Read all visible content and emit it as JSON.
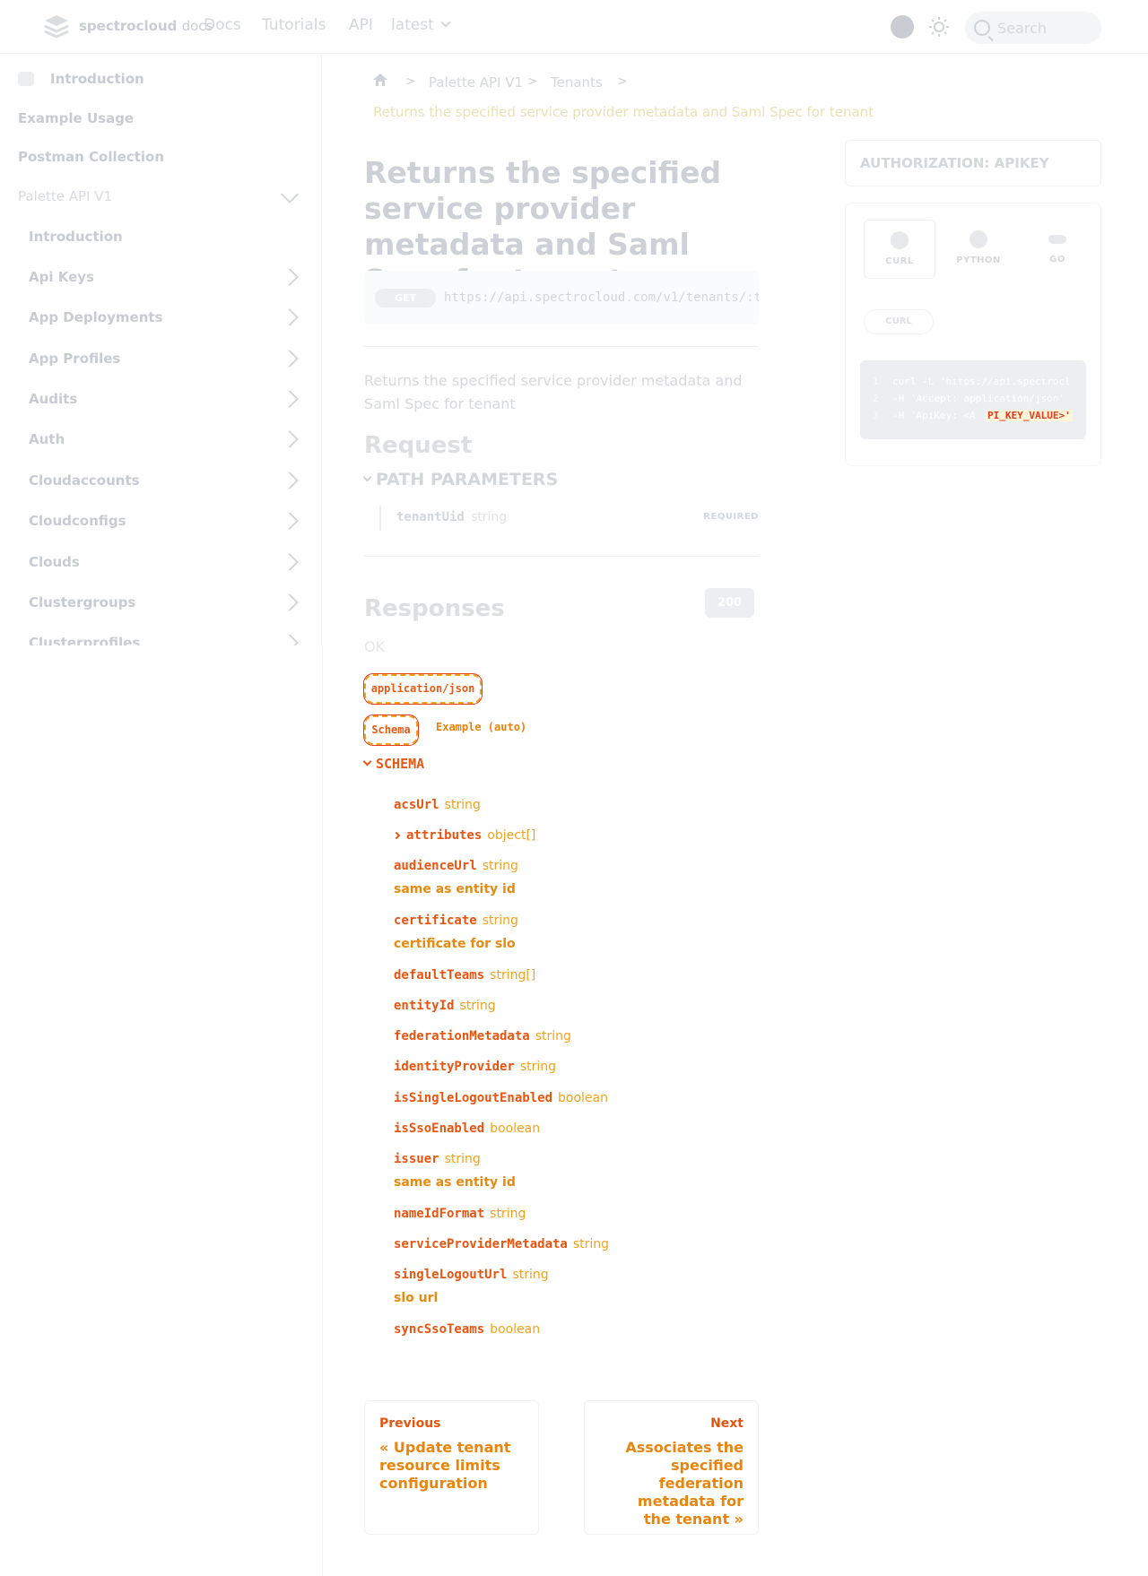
{
  "nav": {
    "logo_brand": "spectrocloud",
    "logo_suffix": "docs",
    "links": [
      "Docs",
      "Tutorials",
      "API",
      "latest"
    ],
    "search_placeholder": "Search"
  },
  "sidebar": {
    "top_items": [
      "Introduction",
      "Example Usage",
      "Postman Collection",
      "Palette API V1"
    ],
    "sub_items": [
      "Introduction",
      "Api Keys",
      "App Deployments",
      "App Profiles",
      "Audits",
      "Auth",
      "Cloudaccounts",
      "Cloudconfigs",
      "Clouds",
      "Clustergroups",
      "Clusterprofiles"
    ]
  },
  "breadcrumb": {
    "items": [
      "Palette API V1",
      "Tenants"
    ],
    "current": "Returns the specified service provider metadata and Saml Spec for tenant"
  },
  "endpoint": {
    "title": "Returns the specified service provider metadata and Saml Spec for tenant",
    "method": "GET",
    "url": "https://api.spectrocloud.com/v1/tenants/:t",
    "description": "Returns the specified service provider metadata and Saml Spec for tenant"
  },
  "request": {
    "heading": "Request",
    "path_params_heading": "PATH PARAMETERS",
    "params": [
      {
        "name": "tenantUid",
        "type": "string",
        "required": "REQUIRED"
      }
    ]
  },
  "responses": {
    "heading": "Responses",
    "code": "200",
    "status": "OK",
    "content_type": "application/json",
    "tabs": [
      "Schema",
      "Example (auto)"
    ],
    "schema_heading": "SCHEMA",
    "fields": [
      {
        "name": "acsUrl",
        "type": "string",
        "desc": ""
      },
      {
        "name": "attributes",
        "type": "object[]",
        "desc": "",
        "expandable": true
      },
      {
        "name": "audienceUrl",
        "type": "string",
        "desc": "same as entity id"
      },
      {
        "name": "certificate",
        "type": "string",
        "desc": "certificate for slo"
      },
      {
        "name": "defaultTeams",
        "type": "string[]",
        "desc": ""
      },
      {
        "name": "entityId",
        "type": "string",
        "desc": ""
      },
      {
        "name": "federationMetadata",
        "type": "string",
        "desc": ""
      },
      {
        "name": "identityProvider",
        "type": "string",
        "desc": ""
      },
      {
        "name": "isSingleLogoutEnabled",
        "type": "boolean",
        "desc": ""
      },
      {
        "name": "isSsoEnabled",
        "type": "boolean",
        "desc": ""
      },
      {
        "name": "issuer",
        "type": "string",
        "desc": "same as entity id"
      },
      {
        "name": "nameIdFormat",
        "type": "string",
        "desc": ""
      },
      {
        "name": "serviceProviderMetadata",
        "type": "string",
        "desc": ""
      },
      {
        "name": "singleLogoutUrl",
        "type": "string",
        "desc": "slo url"
      },
      {
        "name": "syncSsoTeams",
        "type": "boolean",
        "desc": ""
      }
    ]
  },
  "pager": {
    "prev_label": "Previous",
    "prev_title": "« Update tenant resource limits configuration",
    "next_label": "Next",
    "next_title": "Associates the specified federation metadata for the tenant »"
  },
  "right_panel": {
    "auth_title": "AUTHORIZATION: APIKEY",
    "languages": [
      "CURL",
      "PYTHON",
      "GO"
    ],
    "active_tab": "CURL",
    "code_lines": [
      {
        "n": "1",
        "text": "curl -L 'https://api.spectrocl"
      },
      {
        "n": "2",
        "text": "-H 'Accept: application/json'"
      },
      {
        "n": "3",
        "text": "-H 'ApiKey: <A"
      }
    ],
    "code_key": "PI_KEY_VALUE>'"
  },
  "colors": {
    "accent_orange": "#e9540f",
    "accent_yellow": "#f2a21a",
    "muted": "#c9ccd3"
  }
}
